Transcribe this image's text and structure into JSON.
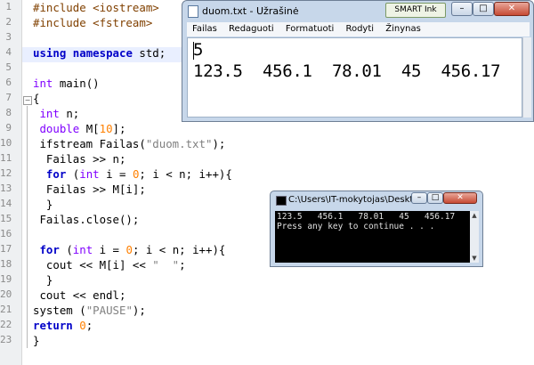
{
  "editor": {
    "line_numbers": [
      "1",
      "2",
      "3",
      "4",
      "5",
      "6",
      "7",
      "8",
      "9",
      "10",
      "11",
      "12",
      "13",
      "14",
      "15",
      "16",
      "17",
      "18",
      "19",
      "20",
      "21",
      "22",
      "23"
    ],
    "lines": [
      "#include <iostream>",
      "#include <fstream>",
      "",
      "using namespace std;",
      "",
      "int main()",
      "{",
      " int n;",
      " double M[10];",
      " ifstream Failas(\"duom.txt\");",
      "  Failas >> n;",
      "  for (int i = 0; i < n; i++){",
      "  Failas >> M[i];",
      "  }",
      " Failas.close();",
      "",
      " for (int i = 0; i < n; i++){",
      "  cout << M[i] << \"  \";",
      "  }",
      " cout << endl;",
      "system (\"PAUSE\");",
      "return 0;",
      "}"
    ]
  },
  "notepad": {
    "title": "duom.txt - Užrašinė",
    "smart_ink": "SMART Ink",
    "menu": [
      "Failas",
      "Redaguoti",
      "Formatuoti",
      "Rodyti",
      "Žinynas"
    ],
    "content": [
      "5",
      "123.5  456.1  78.01  45  456.17"
    ],
    "controls": {
      "minimize": "–",
      "maximize": "□",
      "close": "✕"
    }
  },
  "console": {
    "title": "C:\\Users\\IT-mokytojas\\Deskto...",
    "lines": [
      "123.5   456.1   78.01   45   456.17",
      "Press any key to continue . . ."
    ],
    "controls": {
      "minimize": "–",
      "maximize": "□",
      "close": "✕"
    }
  },
  "colors": {
    "keyword": "#0000c8",
    "type": "#8000ff",
    "preprocessor": "#804000",
    "number": "#ff8000",
    "string": "#808080",
    "current_line": "#e9efff"
  }
}
